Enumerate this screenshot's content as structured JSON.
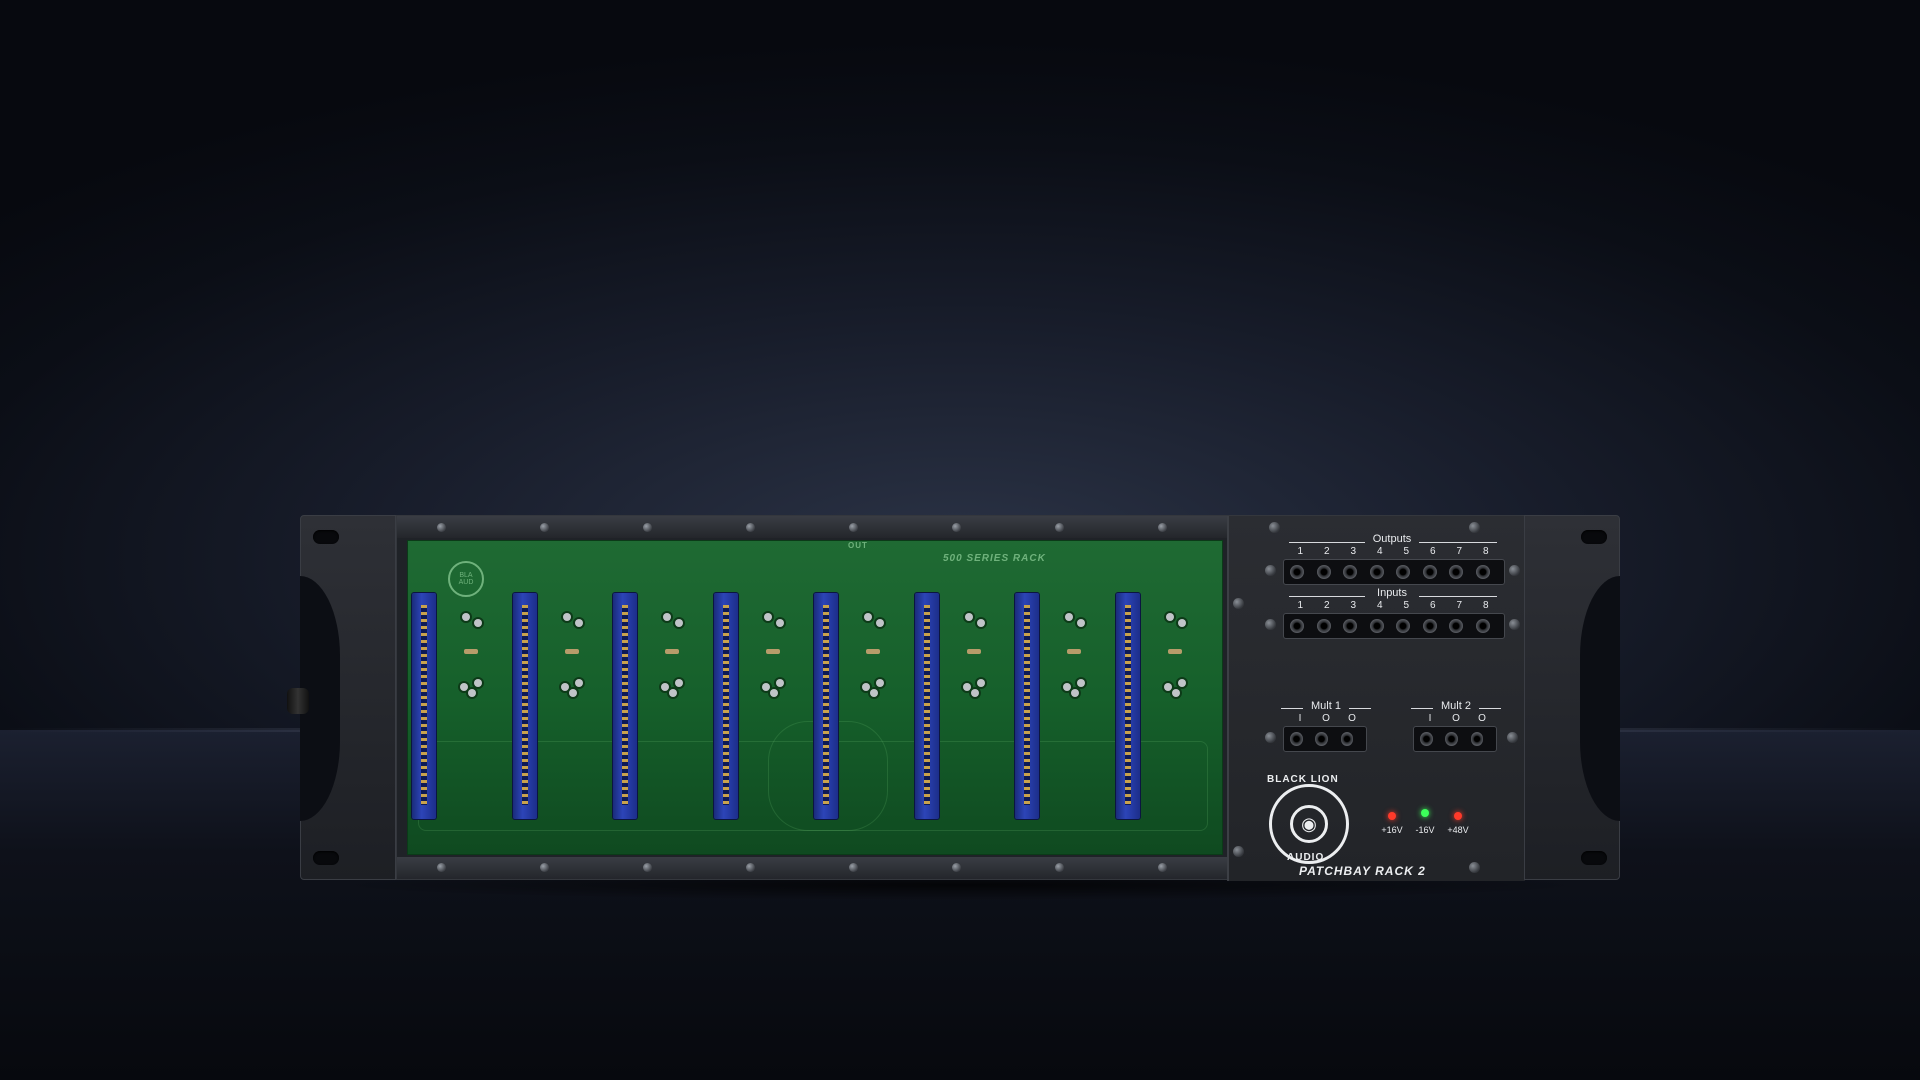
{
  "scene": {
    "colors": {
      "background": "#0b0e16",
      "pcb": "#16602b",
      "connector": "#2c44b8",
      "panel": "#2b2d32"
    }
  },
  "pcb": {
    "silkscreen_title": "500 SERIES RACK",
    "silkscreen_out": "OUT",
    "slot_count": 8
  },
  "patchbay": {
    "outputs_label": "Outputs",
    "inputs_label": "Inputs",
    "channel_numbers": [
      "1",
      "2",
      "3",
      "4",
      "5",
      "6",
      "7",
      "8"
    ],
    "mult1_label": "Mult 1",
    "mult2_label": "Mult 2",
    "mult_io": [
      "I",
      "O",
      "O"
    ],
    "power_leds": [
      {
        "label": "+16V",
        "color": "#ff3a2a"
      },
      {
        "label": "-16V",
        "color": "#3cff5a"
      },
      {
        "label": "+48V",
        "color": "#ff3a2a"
      }
    ],
    "brand_top": "BLACK LION",
    "brand_bottom": "AUDIO",
    "model_name": "PATCHBAY RACK 2"
  }
}
